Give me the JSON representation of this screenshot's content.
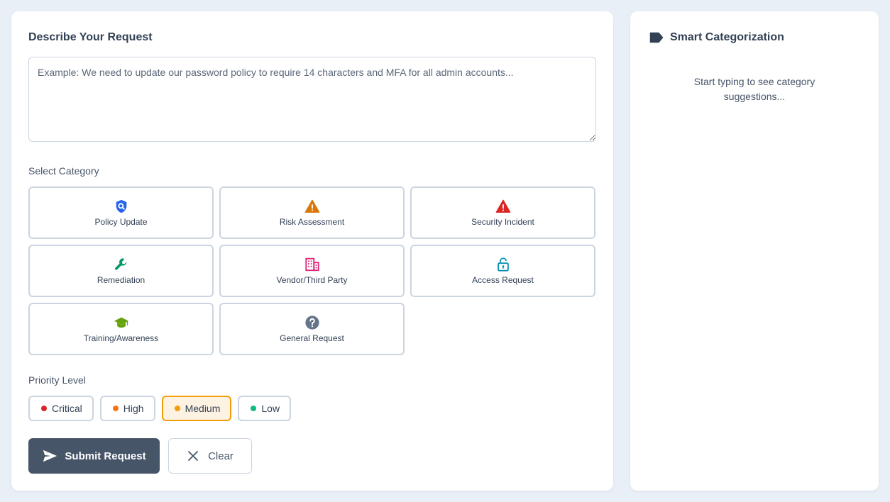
{
  "request": {
    "title": "Describe Your Request",
    "placeholder": "Example: We need to update our password policy to require 14 characters and MFA for all admin accounts...",
    "value": ""
  },
  "category": {
    "label": "Select Category",
    "items": [
      {
        "label": "Policy Update",
        "icon": "shield-search-icon",
        "color": "#2563eb"
      },
      {
        "label": "Risk Assessment",
        "icon": "warning-triangle-icon",
        "color": "#d97706"
      },
      {
        "label": "Security Incident",
        "icon": "alert-triangle-icon",
        "color": "#dc2626"
      },
      {
        "label": "Remediation",
        "icon": "wrench-icon",
        "color": "#059669"
      },
      {
        "label": "Vendor/Third Party",
        "icon": "building-icon",
        "color": "#db2777"
      },
      {
        "label": "Access Request",
        "icon": "unlock-icon",
        "color": "#0891b2"
      },
      {
        "label": "Training/Awareness",
        "icon": "graduation-cap-icon",
        "color": "#65a30d"
      },
      {
        "label": "General Request",
        "icon": "question-circle-icon",
        "color": "#64748b"
      }
    ]
  },
  "priority": {
    "label": "Priority Level",
    "selected": "Medium",
    "levels": [
      {
        "label": "Critical",
        "color": "#dc2626"
      },
      {
        "label": "High",
        "color": "#f97316"
      },
      {
        "label": "Medium",
        "color": "#f59e0b"
      },
      {
        "label": "Low",
        "color": "#10b981"
      }
    ]
  },
  "actions": {
    "submit_label": "Submit Request",
    "submit_icon": "send-icon",
    "clear_label": "Clear",
    "clear_icon": "close-icon"
  },
  "sidebar": {
    "title": "Smart Categorization",
    "icon": "tag-icon",
    "hint": "Start typing to see category suggestions..."
  },
  "colors": {
    "page_bg": "#e9eff7",
    "primary_button": "#475569",
    "selected_priority_border": "#f59e0b",
    "selected_priority_bg": "#fef3e2"
  }
}
